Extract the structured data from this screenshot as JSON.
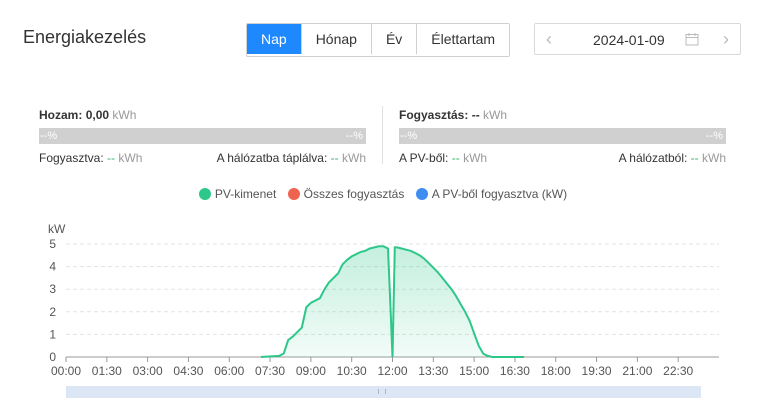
{
  "header": {
    "title": "Energiakezelés",
    "tabs": [
      "Nap",
      "Hónap",
      "Év",
      "Élettartam"
    ],
    "active_tab": "Nap",
    "date": "2024-01-09",
    "accent": "#1e88ff"
  },
  "yield_panel": {
    "label": "Hozam:",
    "value": "0,00",
    "unit": "kWh",
    "bar_left": "--%",
    "bar_right": "--%",
    "left_label": "Fogyasztva:",
    "left_value": "--",
    "left_unit": "kWh",
    "right_label": "A hálózatba táplálva:",
    "right_value": "--",
    "right_unit": "kWh"
  },
  "consumption_panel": {
    "label": "Fogyasztás:",
    "value": "--",
    "unit": "kWh",
    "bar_left": "--%",
    "bar_right": "--%",
    "left_label": "A PV-ből:",
    "left_value": "--",
    "left_unit": "kWh",
    "right_label": "A hálózatból:",
    "right_value": "--",
    "right_unit": "kWh"
  },
  "legend": [
    {
      "name": "PV-kimenet",
      "color": "#2dc78a"
    },
    {
      "name": "Összes fogyasztás",
      "color": "#ef6350"
    },
    {
      "name": "A PV-ből fogyasztva (kW)",
      "color": "#3d8ef0"
    }
  ],
  "chart_data": {
    "type": "area",
    "ylabel": "kW",
    "ylim": [
      0,
      5
    ],
    "yticks": [
      "0",
      "1",
      "2",
      "3",
      "4",
      "5"
    ],
    "xticks": [
      "00:00",
      "01:30",
      "03:00",
      "04:30",
      "06:00",
      "07:30",
      "09:00",
      "10:30",
      "12:00",
      "13:30",
      "15:00",
      "16:30",
      "18:00",
      "19:30",
      "21:00",
      "22:30"
    ],
    "x_range_hours": [
      0,
      24
    ],
    "grid": true,
    "series": [
      {
        "name": "PV-kimenet",
        "color": "#2dc78a",
        "x": [
          "07:10",
          "07:50",
          "08:00",
          "08:10",
          "08:20",
          "08:30",
          "08:40",
          "08:50",
          "09:00",
          "09:10",
          "09:20",
          "09:30",
          "09:40",
          "09:50",
          "10:00",
          "10:10",
          "10:20",
          "10:30",
          "10:40",
          "10:50",
          "11:00",
          "11:10",
          "11:20",
          "11:30",
          "11:40",
          "11:50",
          "11:55",
          "12:00",
          "12:05",
          "12:10",
          "12:20",
          "12:30",
          "12:40",
          "12:50",
          "13:00",
          "13:10",
          "13:20",
          "13:30",
          "13:40",
          "13:50",
          "14:00",
          "14:10",
          "14:20",
          "14:30",
          "14:40",
          "14:50",
          "15:00",
          "15:10",
          "15:20",
          "15:30",
          "15:40",
          "15:50",
          "16:00",
          "16:30",
          "16:50"
        ],
        "values": [
          0.0,
          0.05,
          0.15,
          0.75,
          0.9,
          1.1,
          1.3,
          2.2,
          2.4,
          2.5,
          2.6,
          3.0,
          3.3,
          3.5,
          3.7,
          4.1,
          4.3,
          4.45,
          4.55,
          4.65,
          4.7,
          4.8,
          4.85,
          4.9,
          4.9,
          4.8,
          2.5,
          0.0,
          4.85,
          4.85,
          4.8,
          4.75,
          4.7,
          4.6,
          4.5,
          4.35,
          4.15,
          3.95,
          3.75,
          3.5,
          3.25,
          3.0,
          2.7,
          2.35,
          2.0,
          1.6,
          1.05,
          0.5,
          0.15,
          0.05,
          0.0,
          0.0,
          0.0,
          0.0,
          0.0
        ]
      }
    ]
  }
}
